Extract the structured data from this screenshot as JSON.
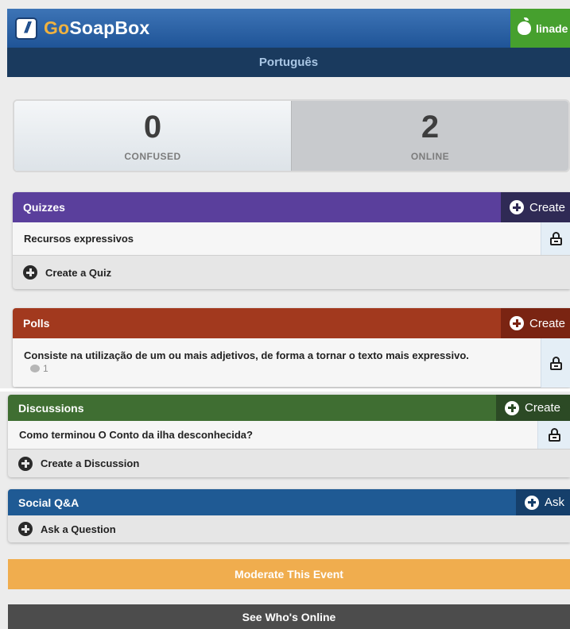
{
  "app": {
    "logo_prefix": "Go",
    "logo_suffix": "SoapBox",
    "user_label": "linade"
  },
  "event": {
    "title": "Português"
  },
  "stats": {
    "confused": {
      "value": "0",
      "label": "CONFUSED"
    },
    "online": {
      "value": "2",
      "label": "ONLINE"
    }
  },
  "quizzes": {
    "title": "Quizzes",
    "create_label": "Create",
    "color": "#5a3f9c",
    "items": [
      {
        "label": "Recursos expressivos"
      }
    ],
    "action_label": "Create a Quiz"
  },
  "polls": {
    "title": "Polls",
    "create_label": "Create",
    "color": "#a2391e",
    "items": [
      {
        "label": "Consiste na utilização de um ou mais adjetivos, de forma a tornar o texto mais expressivo.",
        "comments": "1"
      }
    ]
  },
  "discussions": {
    "title": "Discussions",
    "create_label": "Create",
    "color": "#3f6e32",
    "items": [
      {
        "label": "Como terminou O Conto da ilha desconhecida?"
      }
    ],
    "action_label": "Create a Discussion"
  },
  "social_qa": {
    "title": "Social Q&A",
    "create_label": "Ask",
    "color": "#1f5a94",
    "action_label": "Ask a Question"
  },
  "buttons": {
    "moderate": {
      "label": "Moderate This Event",
      "color": "#f0ad4e"
    },
    "who_online": {
      "label": "See Who's Online",
      "color": "#4c4c4c"
    }
  }
}
